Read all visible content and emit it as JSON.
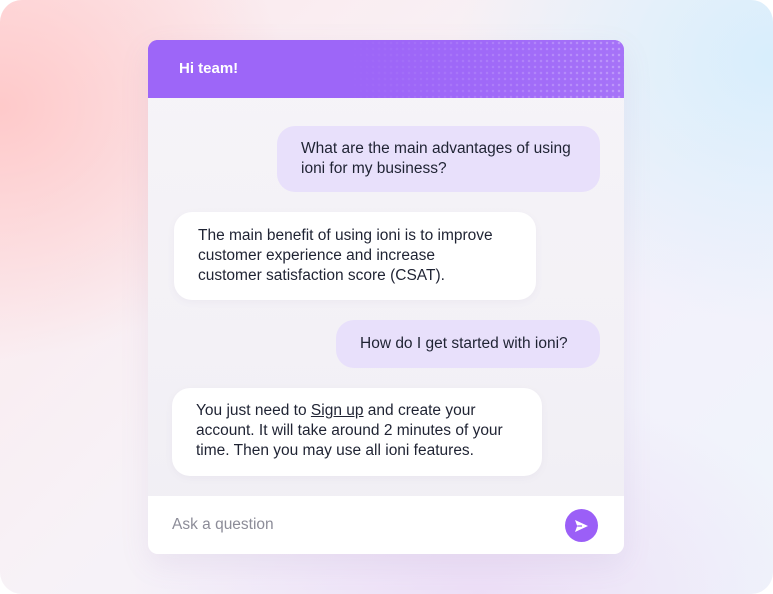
{
  "header": {
    "title": "Hi team!"
  },
  "messages": [
    {
      "role": "user",
      "lines": [
        "What are the main advantages of using",
        "ioni for my business?"
      ]
    },
    {
      "role": "bot",
      "lines": [
        "The main benefit of using ioni is to improve",
        "customer experience and increase",
        "customer satisfaction score (CSAT)."
      ]
    },
    {
      "role": "user",
      "lines": [
        "How do I get started with ioni?"
      ]
    },
    {
      "role": "bot",
      "line1_prefix": "You just need to ",
      "link_text": "Sign up",
      "line1_suffix": " and create your",
      "lines_rest": [
        "account. It will take around 2 minutes of your",
        "time. Then you may use all ioni features."
      ]
    }
  ],
  "input": {
    "placeholder": "Ask a question",
    "value": ""
  },
  "send": {
    "icon": "send-icon"
  },
  "colors": {
    "accent": "#9d66f8",
    "user_bubble": "#e8e0fb",
    "bot_bubble": "#ffffff",
    "text": "#1f2333"
  }
}
